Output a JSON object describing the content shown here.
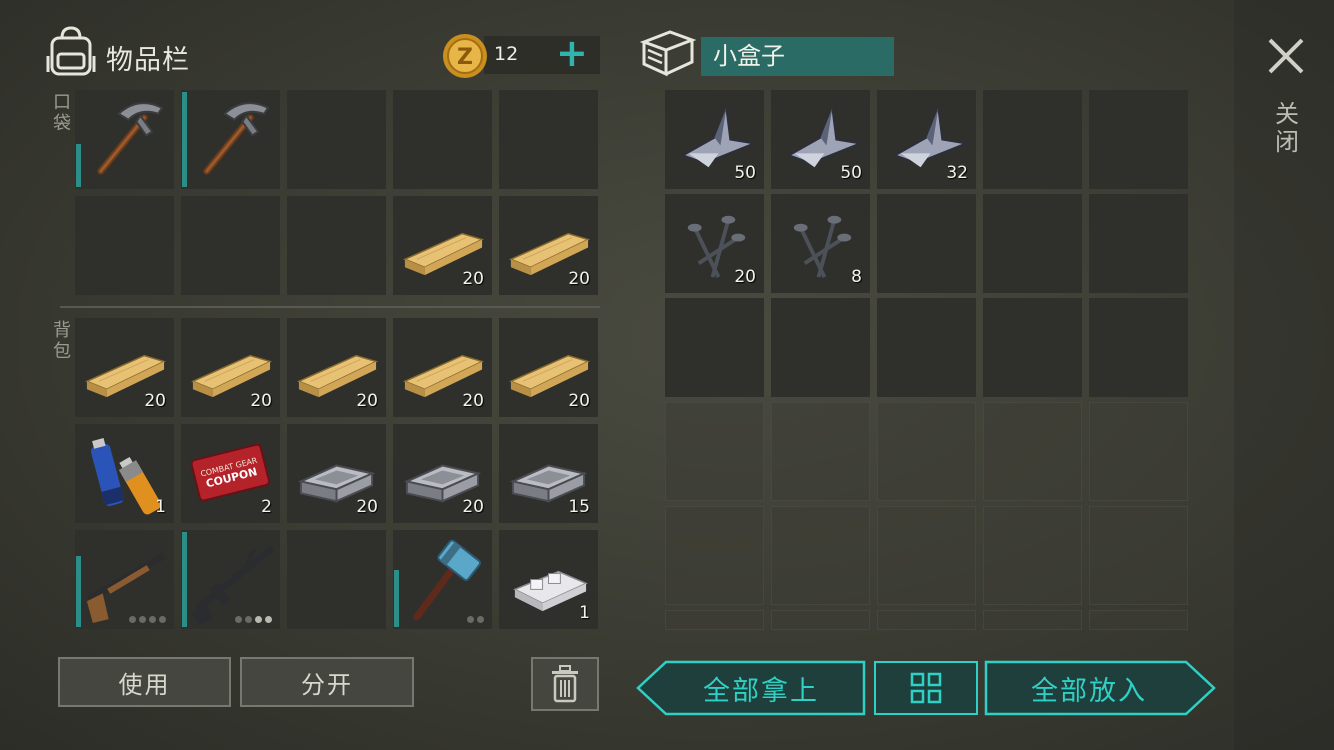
{
  "inventory": {
    "title": "物品栏",
    "coins": "12",
    "pocket_label": "口袋",
    "backpack_label": "背包",
    "pocket_slots": [
      {
        "item": "pickaxe",
        "count": "",
        "durability": 0.45
      },
      {
        "item": "pickaxe",
        "count": "",
        "durability": 1.0
      },
      {
        "item": "",
        "count": ""
      },
      {
        "item": "",
        "count": ""
      },
      {
        "item": "",
        "count": ""
      },
      {
        "item": "",
        "count": ""
      },
      {
        "item": "",
        "count": ""
      },
      {
        "item": "",
        "count": ""
      },
      {
        "item": "plank",
        "count": "20"
      },
      {
        "item": "plank",
        "count": "20"
      }
    ],
    "backpack_slots": [
      {
        "item": "plank",
        "count": "20"
      },
      {
        "item": "plank",
        "count": "20"
      },
      {
        "item": "plank",
        "count": "20"
      },
      {
        "item": "plank",
        "count": "20"
      },
      {
        "item": "plank",
        "count": "20"
      },
      {
        "item": "batteries",
        "count": "1"
      },
      {
        "item": "coupon",
        "count": "2"
      },
      {
        "item": "iron-bar",
        "count": "20"
      },
      {
        "item": "iron-bar",
        "count": "20"
      },
      {
        "item": "iron-bar",
        "count": "15"
      },
      {
        "item": "shotgun",
        "count": "",
        "durability": 0.75,
        "dots": 4,
        "dots_on": 0
      },
      {
        "item": "rifle",
        "count": "",
        "durability": 1.0,
        "dots": 4,
        "dots_on": 2
      },
      {
        "item": "",
        "count": ""
      },
      {
        "item": "sledgehammer",
        "count": "",
        "durability": 0.6,
        "dots": 2,
        "dots_on": 0
      },
      {
        "item": "silver-bar",
        "count": "1"
      }
    ],
    "use_label": "使用",
    "split_label": "分开"
  },
  "container": {
    "name": "小盒子",
    "slots": [
      {
        "item": "scrap-metal",
        "count": "50"
      },
      {
        "item": "scrap-metal",
        "count": "50"
      },
      {
        "item": "scrap-metal",
        "count": "32"
      },
      {
        "item": "",
        "count": ""
      },
      {
        "item": "",
        "count": ""
      },
      {
        "item": "nails",
        "count": "20"
      },
      {
        "item": "nails",
        "count": "8"
      },
      {
        "item": "",
        "count": ""
      },
      {
        "item": "",
        "count": ""
      },
      {
        "item": "",
        "count": ""
      },
      {
        "item": "",
        "count": ""
      },
      {
        "item": "",
        "count": ""
      },
      {
        "item": "",
        "count": ""
      },
      {
        "item": "",
        "count": ""
      },
      {
        "item": "",
        "count": ""
      }
    ],
    "take_all_label": "全部拿上",
    "put_all_label": "全部放入"
  },
  "close_label": "关闭",
  "colors": {
    "accent": "#2fd0c5",
    "durability": "#2c8e89",
    "name_bg": "#2b6b66"
  }
}
